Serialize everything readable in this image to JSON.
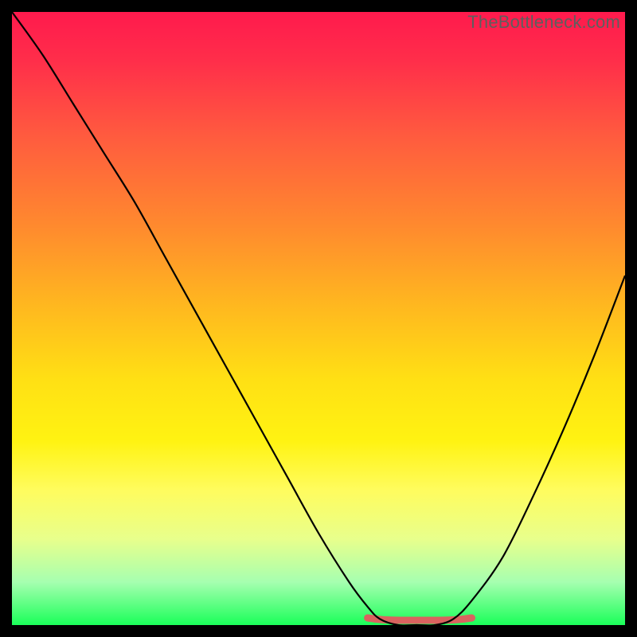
{
  "watermark": "TheBottleneck.com",
  "colors": {
    "frame": "#000000",
    "line": "#000000",
    "bottom_highlight": "#d9635f",
    "gradient_stops": [
      "#ff1a4d",
      "#ff2e4a",
      "#ff5a3f",
      "#ff8a2e",
      "#ffb81f",
      "#ffe014",
      "#fff312",
      "#fffc5e",
      "#e8ff8c",
      "#a6ffb0",
      "#1aff59"
    ]
  },
  "chart_data": {
    "type": "line",
    "title": "",
    "xlabel": "",
    "ylabel": "",
    "xlim": [
      0,
      100
    ],
    "ylim": [
      0,
      100
    ],
    "series": [
      {
        "name": "curve",
        "x": [
          0,
          5,
          10,
          15,
          20,
          25,
          30,
          35,
          40,
          45,
          50,
          55,
          58,
          60,
          63,
          66,
          69,
          72,
          75,
          80,
          85,
          90,
          95,
          100
        ],
        "values": [
          100,
          93,
          85,
          77,
          69,
          60,
          51,
          42,
          33,
          24,
          15,
          7,
          3,
          1,
          0,
          0,
          0,
          1,
          4,
          11,
          21,
          32,
          44,
          57
        ]
      }
    ],
    "bottom_highlight": {
      "x_start": 58,
      "x_end": 75,
      "y": 0
    }
  }
}
